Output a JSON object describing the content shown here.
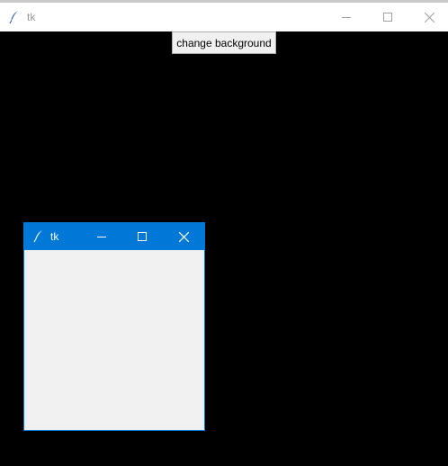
{
  "main_window": {
    "title": "tk",
    "app_icon": "feather-icon",
    "controls": [
      "minimize-icon",
      "maximize-icon",
      "close-icon"
    ],
    "titlebar_color": "#ffffff",
    "background_color": "#000000",
    "button_label": "change background"
  },
  "child_window": {
    "title": "tk",
    "app_icon": "feather-icon",
    "controls": [
      "minimize-icon",
      "maximize-icon",
      "close-icon"
    ],
    "titlebar_color": "#0078d7",
    "background_color": "#f0f0f0"
  }
}
